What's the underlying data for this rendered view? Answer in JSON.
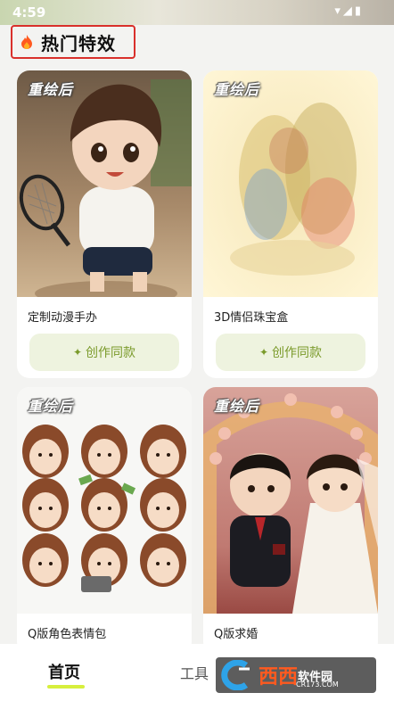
{
  "status": {
    "time": "4:59"
  },
  "section": {
    "title": "热门特效",
    "icon": "flame-icon"
  },
  "badge_text": "重绘后",
  "cards": [
    {
      "title": "定制动漫手办",
      "button": "创作同款"
    },
    {
      "title": "3D情侣珠宝盒",
      "button": "创作同款"
    },
    {
      "title": "Q版角色表情包"
    },
    {
      "title": "Q版求婚"
    }
  ],
  "nav": {
    "home": "首页",
    "tools": "工具",
    "accent": "#d7ef3d"
  },
  "watermark": {
    "brand": "西西",
    "sub": "软件园",
    "url": "CR173.COM"
  },
  "colors": {
    "highlight_border": "#d9302b",
    "button_text": "#7a9a2a",
    "button_bg": "#eef3df"
  }
}
